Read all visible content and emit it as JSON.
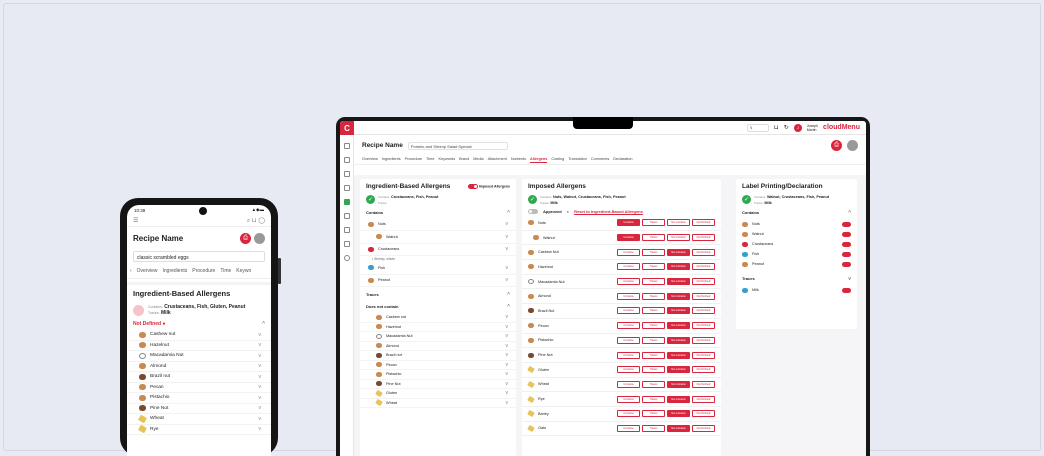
{
  "phone": {
    "status_time": "10:38",
    "status_icons": "▲◆▬",
    "title": "Recipe Name",
    "recipe_input": "classic scrambled eggs",
    "tabs": [
      "Overview",
      "Ingredients",
      "Procedure",
      "Time",
      "Keywo"
    ],
    "section_title": "Ingredient-Based Allergens",
    "contains_label": "Contains:",
    "contains_value": "Crustaceans, Fish, Gluten, Peanut",
    "traces_label": "Traces:",
    "traces_value": "Milk",
    "not_defined": "Not Defined",
    "rows": [
      "Cashew nut",
      "Hazelnut",
      "Macadamia Nut",
      "Almond",
      "Brazil nut",
      "Pecan",
      "Pistachio",
      "Pine Nut",
      "Wheat",
      "Rye"
    ]
  },
  "laptop": {
    "logo": "C",
    "select_value": "$",
    "user_name": "Joseph",
    "user_sub": "Martin",
    "brand": "cloudMenu",
    "recipe_label": "Recipe Name",
    "recipe_value": "Pomelo and Shrimp Salad Special",
    "tabs": [
      "Overview",
      "Ingredients",
      "Procedure",
      "Time",
      "Keywords",
      "Brand",
      "Media",
      "Attachment",
      "Nutrients",
      "Allergens",
      "Costing",
      "Translation",
      "Comments",
      "Declaration"
    ],
    "active_tab": "Allergens",
    "ingredient": {
      "title": "Ingredient-Based Allergens",
      "imposed_toggle": "Imposed Allergens",
      "contains_label": "Contains:",
      "contains_value": "Crustaceans, Fish, Peanut",
      "traces_label": "Traces:",
      "contains_section": "Contains",
      "contains_rows": [
        {
          "name": "Nuts",
          "sub": false
        },
        {
          "name": "Walnut",
          "sub": true
        },
        {
          "name": "Crustaceans",
          "sub": false
        },
        {
          "name": "Fish",
          "sub": false
        },
        {
          "name": "Peanut",
          "sub": false
        }
      ],
      "shrimp_note": "• Shrimp, whole",
      "traces_section": "Traces",
      "does_not_contain": "Does not contain",
      "dnc_rows": [
        "Cashew nut",
        "Hazelnut",
        "Macadamia Nut",
        "Almond",
        "Brazil nut",
        "Pecan",
        "Pistachio",
        "Pine Nut",
        "Gluten",
        "Wheat"
      ]
    },
    "imposed": {
      "title": "Imposed Allergens",
      "contains_label": "Contains:",
      "contains_value": "Nuts, Walnut, Crustaceans, Fish, Peanut",
      "traces_label": "Traces:",
      "traces_value": "Milk",
      "approved": "Approved",
      "reset_link": "Reset to Ingredient-Based Allergens",
      "btn_labels": [
        "Contains",
        "Traces",
        "Not contains",
        "Not Defined"
      ],
      "rows": [
        {
          "name": "Nuts",
          "state": 0
        },
        {
          "name": "Walnut",
          "state": 0
        },
        {
          "name": "Cashew Nut",
          "state": 2
        },
        {
          "name": "Hazelnut",
          "state": 2
        },
        {
          "name": "Macadamia Nut",
          "state": 2
        },
        {
          "name": "Almond",
          "state": 2
        },
        {
          "name": "Brazil Nut",
          "state": 2
        },
        {
          "name": "Pecan",
          "state": 2
        },
        {
          "name": "Pistachio",
          "state": 2
        },
        {
          "name": "Pine Nut",
          "state": 2
        },
        {
          "name": "Gluten",
          "state": 2
        },
        {
          "name": "Wheat",
          "state": 2
        },
        {
          "name": "Rye",
          "state": 2
        },
        {
          "name": "Barley",
          "state": 2
        },
        {
          "name": "Oats",
          "state": 2
        }
      ]
    },
    "label": {
      "title": "Label Printing/Declaration",
      "contains_label": "Contains:",
      "contains_value": "Walnut, Crustaceans, Fish, Peanut",
      "traces_label": "Traces:",
      "traces_value": "Milk",
      "contains_section": "Contains",
      "contains_rows": [
        "Nuts",
        "Walnut",
        "Crustaceans",
        "Fish",
        "Peanut"
      ],
      "traces_section": "Traces",
      "traces_rows": [
        "Milk"
      ]
    }
  },
  "colors": {
    "accent": "#d7263d",
    "ok": "#2fa84f",
    "background": "#e9ebf4"
  }
}
